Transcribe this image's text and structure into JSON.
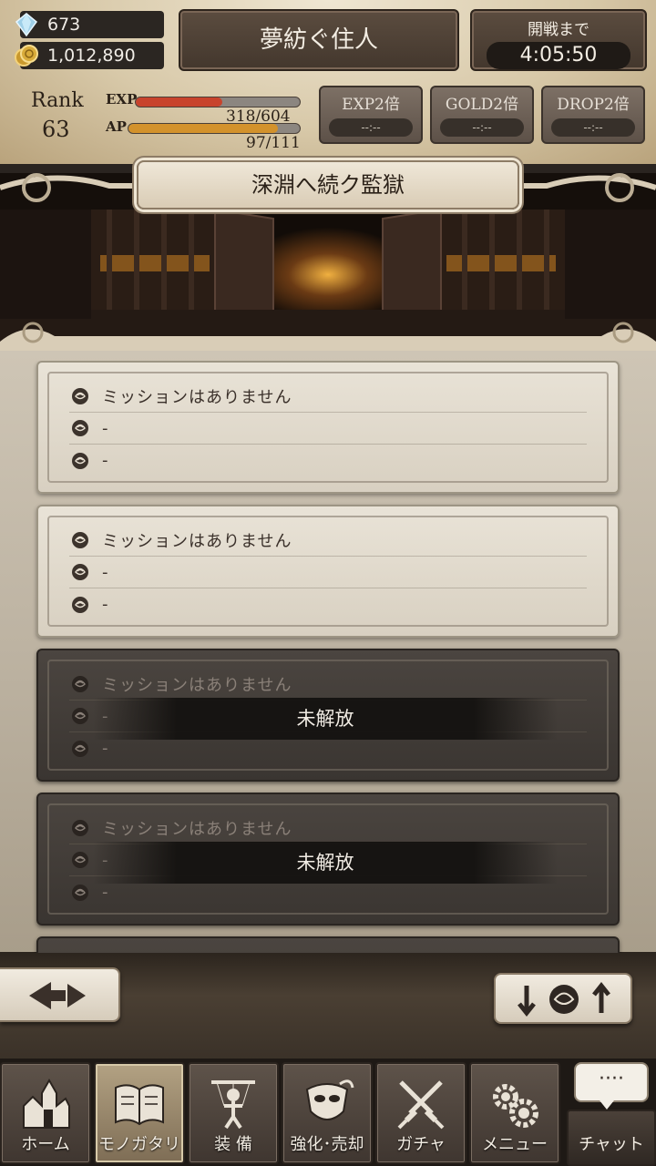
{
  "resources": {
    "gems": "673",
    "gold": "1,012,890"
  },
  "header": {
    "title": "夢紡ぐ住人",
    "timer_label": "開戦まで",
    "timer_value": "4:05:50"
  },
  "player": {
    "rank_label": "Rank",
    "rank_value": "63",
    "exp_label": "EXP",
    "exp_text": "318/604",
    "exp_fraction": 0.53,
    "ap_label": "AP",
    "ap_text": "97/111",
    "ap_fraction": 0.87
  },
  "boosts": [
    {
      "label": "EXP2倍",
      "time": "--:--"
    },
    {
      "label": "GOLD2倍",
      "time": "--:--"
    },
    {
      "label": "DROP2倍",
      "time": "--:--"
    }
  ],
  "location": {
    "title": "深淵へ続ク監獄"
  },
  "missions": [
    {
      "locked": false,
      "rows": [
        "ミッションはありません",
        "-",
        "-"
      ]
    },
    {
      "locked": false,
      "rows": [
        "ミッションはありません",
        "-",
        "-"
      ]
    },
    {
      "locked": true,
      "lock_text": "未解放",
      "rows": [
        "ミッションはありません",
        "-",
        "-"
      ]
    },
    {
      "locked": true,
      "lock_text": "未解放",
      "rows": [
        "ミッションはありません",
        "-",
        "-"
      ]
    }
  ],
  "nav": [
    {
      "label": "ホーム",
      "icon": "home-castle-icon",
      "active": false
    },
    {
      "label": "モノガタリ",
      "icon": "book-icon",
      "active": true
    },
    {
      "label": "装 備",
      "icon": "puppet-equip-icon",
      "active": false
    },
    {
      "label": "強化･売却",
      "icon": "mask-enhance-icon",
      "active": false
    },
    {
      "label": "ガチャ",
      "icon": "crossed-swords-icon",
      "active": false
    },
    {
      "label": "メニュー",
      "icon": "gears-icon",
      "active": false
    }
  ],
  "chat": {
    "label": "チャット",
    "bubble": "····"
  },
  "colors": {
    "exp_bar": "#c8432c",
    "ap_bar": "#d3922c"
  }
}
